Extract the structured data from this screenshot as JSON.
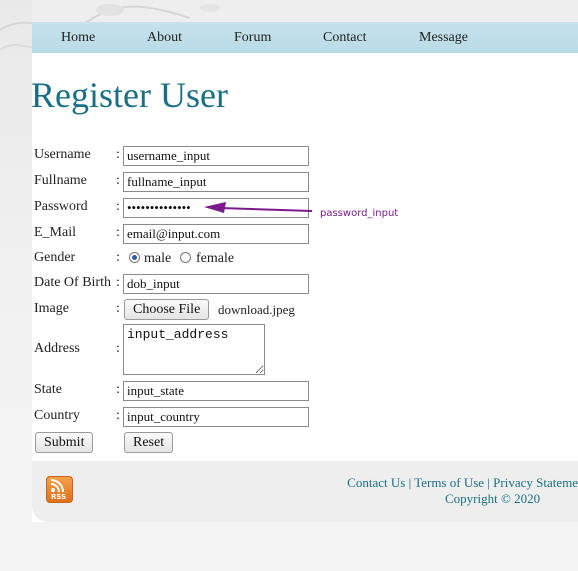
{
  "nav": {
    "items": [
      {
        "label": "Home"
      },
      {
        "label": "About"
      },
      {
        "label": "Forum"
      },
      {
        "label": "Contact"
      },
      {
        "label": "Message"
      }
    ]
  },
  "page": {
    "title": "Register User"
  },
  "form": {
    "username": {
      "label": "Username",
      "value": "username_input"
    },
    "fullname": {
      "label": "Fullname",
      "value": "fullname_input"
    },
    "password": {
      "label": "Password",
      "value": "••••••••••••••",
      "annotation": "password_input"
    },
    "email": {
      "label": "E_Mail",
      "value": "email@input.com"
    },
    "gender": {
      "label": "Gender",
      "options": [
        "male",
        "female"
      ],
      "selected": "male"
    },
    "dob": {
      "label": "Date Of Birth",
      "value": "dob_input"
    },
    "image": {
      "label": "Image",
      "button": "Choose File",
      "filename": "download.jpeg"
    },
    "address": {
      "label": "Address",
      "value": "input_address"
    },
    "state": {
      "label": "State",
      "value": "input_state"
    },
    "country": {
      "label": "Country",
      "value": "input_country"
    },
    "colon": ":",
    "submit_label": "Submit",
    "reset_label": "Reset"
  },
  "footer": {
    "rss": "RSS",
    "links": [
      "Contact Us",
      "Terms of Use",
      "Privacy Stateme"
    ],
    "separator": "|",
    "copyright": "Copyright © 2020"
  },
  "colors": {
    "accent": "#1a6f86",
    "nav_bg": "#c7e2ec",
    "annotation": "#7a1a8c"
  }
}
